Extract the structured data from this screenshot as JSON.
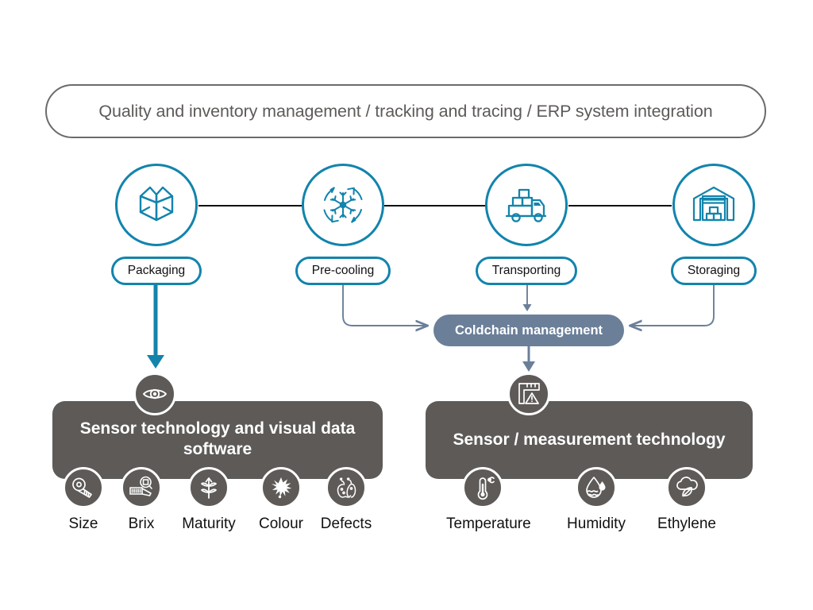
{
  "header": {
    "text": "Quality and inventory management / tracking and tracing / ERP system integration"
  },
  "process_nodes": [
    {
      "label": "Packaging",
      "icon": "open-box-icon"
    },
    {
      "label": "Pre-cooling",
      "icon": "snowflake-cycle-icon"
    },
    {
      "label": "Transporting",
      "icon": "delivery-truck-icon"
    },
    {
      "label": "Storaging",
      "icon": "warehouse-icon"
    }
  ],
  "coldchain": {
    "label": "Coldchain management"
  },
  "panels": [
    {
      "title": "Sensor technology and visual data software",
      "badge_icon": "eye-icon",
      "metrics": [
        {
          "label": "Size",
          "icon": "measuring-tape-icon"
        },
        {
          "label": "Brix",
          "icon": "refractometer-icon"
        },
        {
          "label": "Maturity",
          "icon": "sprout-icon"
        },
        {
          "label": "Colour",
          "icon": "colour-splash-icon"
        },
        {
          "label": "Defects",
          "icon": "blemished-fruit-icon"
        }
      ]
    },
    {
      "title": "Sensor / measurement technology",
      "badge_icon": "measurement-warning-icon",
      "metrics": [
        {
          "label": "Temperature",
          "icon": "thermometer-icon"
        },
        {
          "label": "Humidity",
          "icon": "water-droplet-icon"
        },
        {
          "label": "Ethylene",
          "icon": "leaf-cloud-icon"
        }
      ]
    }
  ],
  "colors": {
    "teal": "#1284ac",
    "slate": "#6b7f99",
    "grey_panel": "#5d5a58",
    "header_border": "#6d6a68",
    "chain_line": "#111111",
    "background": "#ffffff"
  }
}
